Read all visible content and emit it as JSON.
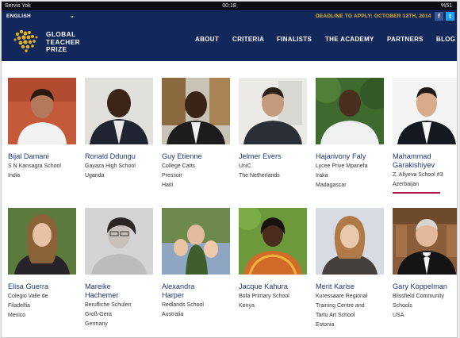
{
  "status_bar": {
    "carrier": "Servis Yok",
    "time": "00:18",
    "battery": "%51"
  },
  "header": {
    "language": "ENGLISH",
    "deadline": "DEADLINE TO APPLY: OCTOBER 12TH, 2014",
    "facebook": "f",
    "twitter": "t",
    "logo_line1": "GLOBAL",
    "logo_line2": "TEACHER",
    "logo_line3": "PRIZE",
    "nav": [
      "ABOUT",
      "CRITERIA",
      "FINALISTS",
      "THE ACADEMY",
      "PARTNERS",
      "BLOG"
    ]
  },
  "colors": {
    "header_bg": "#12285a",
    "accent_gold": "#e6b21c",
    "name_blue": "#20367a",
    "highlight": "#b0164a"
  },
  "finalists": [
    {
      "name": [
        "Bijal Damani"
      ],
      "school": [
        "S N Kansagra School"
      ],
      "country": "India"
    },
    {
      "name": [
        "Ronald Ddungu"
      ],
      "school": [
        "Gayaza High School"
      ],
      "country": "Uganda"
    },
    {
      "name": [
        "Guy Etienne"
      ],
      "school": [
        "College Catts",
        "Pressoir"
      ],
      "country": "Haiti"
    },
    {
      "name": [
        "Jelmer Evers"
      ],
      "school": [
        "UniC"
      ],
      "country": "The Netherlands"
    },
    {
      "name": [
        "Hajarivony Faly"
      ],
      "school": [
        "Lycee Prive Mpanefa",
        "Iraka"
      ],
      "country": "Madagascar"
    },
    {
      "name": [
        "Mahammad",
        "Garakishiyev"
      ],
      "school": [
        "Z. Aliyeva School #3"
      ],
      "country": "Azerbaijan"
    },
    {
      "name": [
        "Elisa Guerra"
      ],
      "school": [
        "Colegio Valle de",
        "Filadelfia"
      ],
      "country": "Mexico"
    },
    {
      "name": [
        "Mareike",
        "Hachemer"
      ],
      "school": [
        "Berufliche Schulen",
        "Groß-Gera"
      ],
      "country": "Germany"
    },
    {
      "name": [
        "Alexandra",
        "Harper"
      ],
      "school": [
        "Redlands School"
      ],
      "country": "Australia"
    },
    {
      "name": [
        "Jacque Kahura"
      ],
      "school": [
        "Bofa Primary School"
      ],
      "country": "Kenya"
    },
    {
      "name": [
        "Merit Karise"
      ],
      "school": [
        "Kuressaare Regional",
        "Training Centre and",
        "Tartu Art School"
      ],
      "country": "Estonia"
    },
    {
      "name": [
        "Gary Koppelman"
      ],
      "school": [
        "Blissfield Community",
        "Schools"
      ],
      "country": "USA"
    }
  ]
}
